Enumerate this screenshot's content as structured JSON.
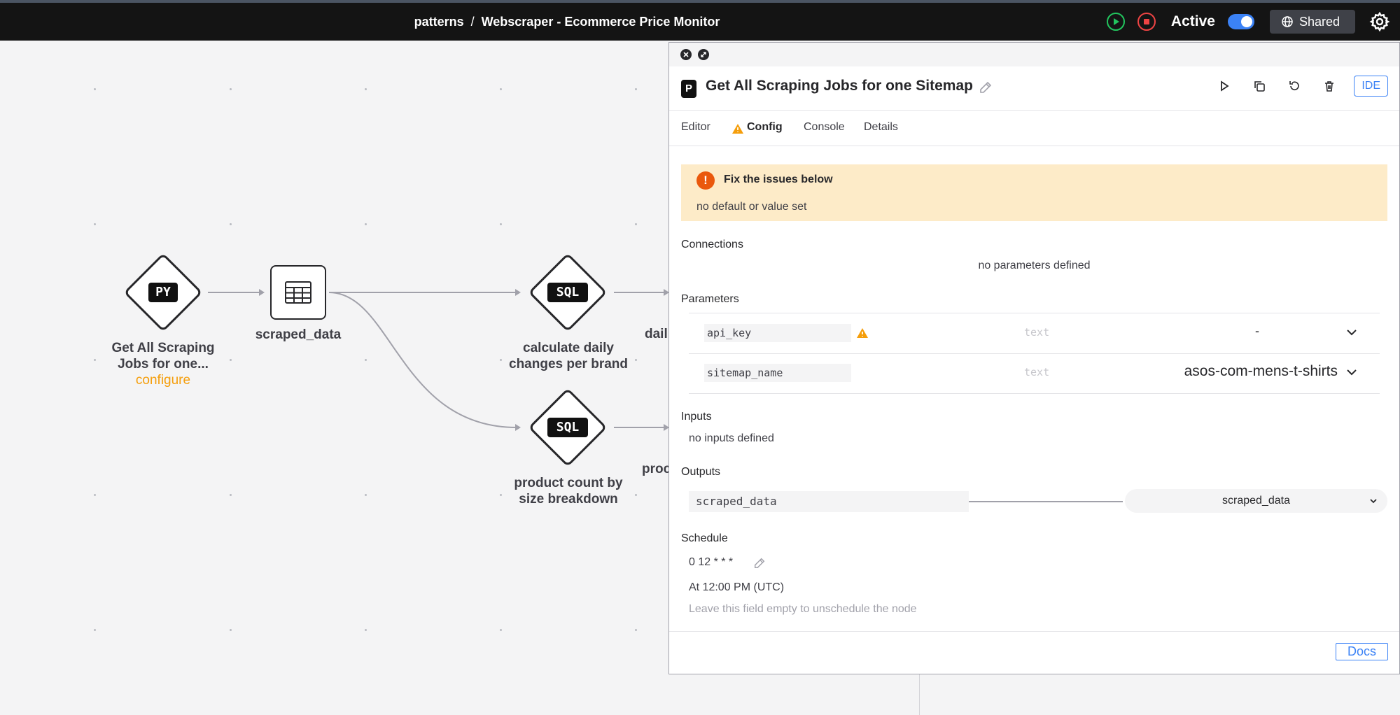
{
  "header": {
    "workspace": "patterns",
    "separator": "/",
    "app_title": "Webscraper - Ecommerce Price Monitor",
    "status_label": "Active",
    "shared_label": "Shared"
  },
  "canvas": {
    "nodes": [
      {
        "badge": "PY",
        "label_line1": "Get All Scraping",
        "label_line2": "Jobs for one...",
        "action": "configure"
      },
      {
        "label": "scraped_data"
      },
      {
        "badge": "SQL",
        "label_line1": "calculate daily",
        "label_line2": "changes per brand"
      },
      {
        "badge": "SQL",
        "label_line1": "product count by",
        "label_line2": "size breakdown"
      }
    ],
    "truncated_labels": [
      "dail",
      "proc"
    ]
  },
  "panel": {
    "icon_letter": "P",
    "title": "Get All Scraping Jobs for one Sitemap",
    "ide_label": "IDE",
    "tabs": [
      "Editor",
      "Config",
      "Console",
      "Details"
    ],
    "warning": {
      "title": "Fix the issues below",
      "message": "no default or value set"
    },
    "connections": {
      "heading": "Connections",
      "empty": "no parameters defined"
    },
    "parameters": {
      "heading": "Parameters",
      "rows": [
        {
          "name": "api_key",
          "type": "text",
          "value": "-"
        },
        {
          "name": "sitemap_name",
          "type": "text",
          "value": "asos-com-mens-t-shirts"
        }
      ]
    },
    "inputs": {
      "heading": "Inputs",
      "empty": "no inputs defined"
    },
    "outputs": {
      "heading": "Outputs",
      "name": "scraped_data",
      "target": "scraped_data"
    },
    "schedule": {
      "heading": "Schedule",
      "cron": "0 12 * * *",
      "human": "At 12:00 PM (UTC)",
      "hint": "Leave this field empty to unschedule the node"
    },
    "docs_label": "Docs"
  }
}
